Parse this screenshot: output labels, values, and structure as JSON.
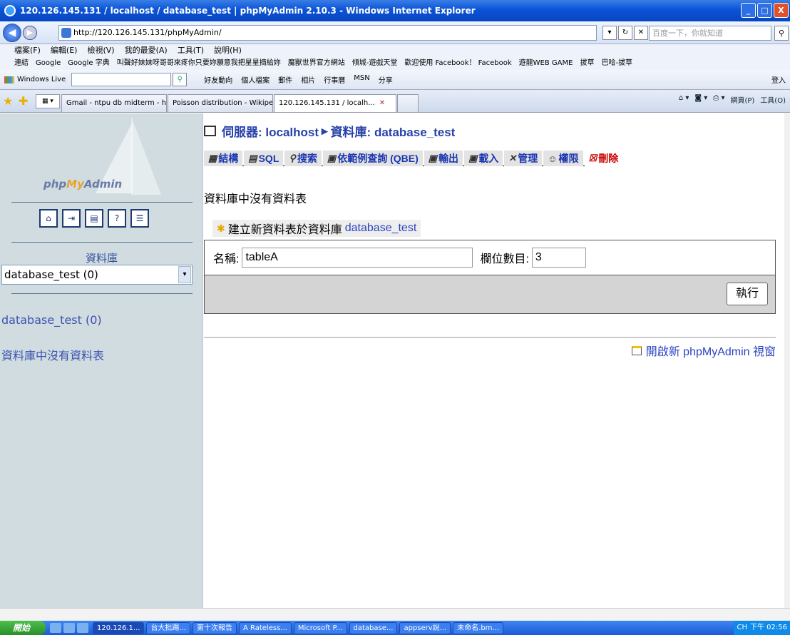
{
  "window": {
    "title": "120.126.145.131 / localhost / database_test | phpMyAdmin 2.10.3 - Windows Internet Explorer",
    "min": "_",
    "max": "□",
    "close": "X"
  },
  "address": {
    "url": "http://120.126.145.131/phpMyAdmin/",
    "search_placeholder": "百度一下，你就知道"
  },
  "menu": [
    "檔案(F)",
    "編輯(E)",
    "檢視(V)",
    "我的最愛(A)",
    "工具(T)",
    "說明(H)"
  ],
  "favorites": [
    "連結",
    "Google",
    "Google 字典",
    "叫聲好妹妹呀哥哥來疼你只要妳願意我把星星摘給妳",
    "魔獸世界官方網站",
    "傾城-遊戲天堂",
    "歡迎使用 Facebook！ Facebook",
    "遊龍WEB GAME",
    "拔草",
    "巴哈-拔草"
  ],
  "live": {
    "label": "Windows Live",
    "items": [
      "好友動向",
      "個人檔案",
      "郵件",
      "相片",
      "行事曆",
      "MSN",
      "分享"
    ],
    "login": "登入"
  },
  "tabs": [
    {
      "label": "Gmail - ntpu db midterm - hgc..."
    },
    {
      "label": "Poisson distribution - Wikiped..."
    },
    {
      "label": "120.126.145.131 / localh..."
    }
  ],
  "tabtools": {
    "page": "網頁(P)",
    "tools": "工具(O)"
  },
  "sidebar": {
    "logo_a": "php",
    "logo_b": "My",
    "logo_c": "Admin",
    "db_label": "資料庫",
    "db_selected": "database_test (0)",
    "db_link": "database_test (0)",
    "no_tables": "資料庫中沒有資料表"
  },
  "main": {
    "crumb_server": "伺服器: localhost",
    "crumb_db": "資料庫: database_test",
    "tabs": [
      "結構",
      "SQL",
      "搜索",
      "依範例查詢 (QBE)",
      "輸出",
      "載入",
      "管理",
      "權限",
      "刪除"
    ],
    "no_tables": "資料庫中沒有資料表",
    "create_legend": "建立新資料表於資料庫",
    "create_db": "database_test",
    "name_label": "名稱:",
    "name_value": "tableA",
    "fields_label": "欄位數目:",
    "fields_value": "3",
    "go_label": "執行",
    "new_window": "開啟新 phpMyAdmin 視窗"
  },
  "taskbar": {
    "start": "開始",
    "items": [
      "120.126.1...",
      "台大批踢...",
      "第十次報告",
      "A Rateless...",
      "Microsoft P...",
      "database...",
      "appserv說...",
      "未命名.bm..."
    ],
    "tray": "CH",
    "time": "下午 02:56"
  }
}
